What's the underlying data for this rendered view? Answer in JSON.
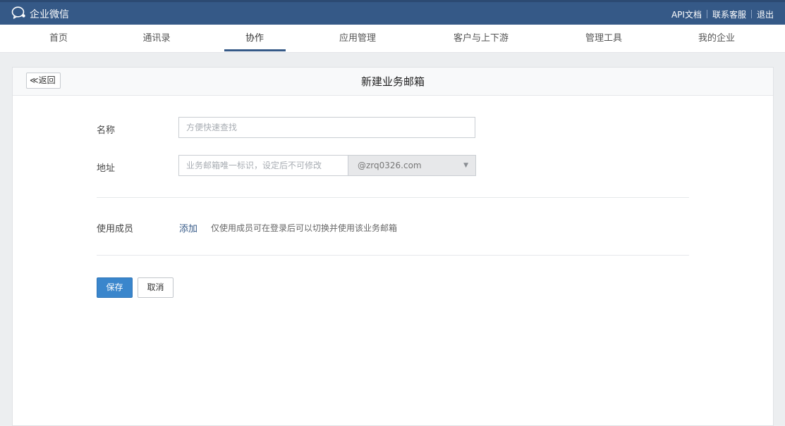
{
  "topbar": {
    "brand": "企业微信",
    "brand_icon": "chat-bubble-icon",
    "links": [
      "API文档",
      "联系客服",
      "退出"
    ]
  },
  "nav": {
    "items": [
      "首页",
      "通讯录",
      "协作",
      "应用管理",
      "客户与上下游",
      "管理工具",
      "我的企业"
    ],
    "active": "协作"
  },
  "page": {
    "back_label": "≪返回",
    "title": "新建业务邮箱"
  },
  "form": {
    "name_label": "名称",
    "name_placeholder": "方便快速查找",
    "address_label": "地址",
    "address_placeholder": "业务邮箱唯一标识，设定后不可修改",
    "domain_value": "@zrq0326.com",
    "domain_caret": "▼",
    "members_label": "使用成员",
    "add_label": "添加",
    "members_hint": "仅使用成员可在登录后可以切换并使用该业务邮箱",
    "save_label": "保存",
    "cancel_label": "取消"
  },
  "colors": {
    "topbar": "#355987",
    "accent": "#3a86cc",
    "link": "#355987"
  }
}
